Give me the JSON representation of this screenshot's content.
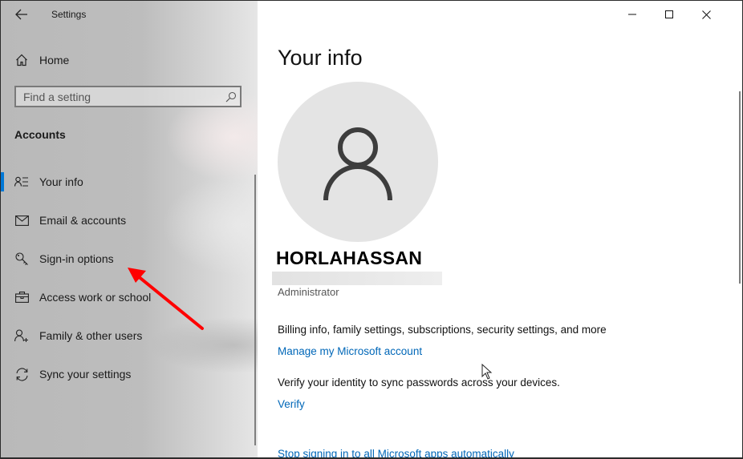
{
  "window": {
    "title": "Settings",
    "controls": {
      "minimize": "minimize-icon",
      "maximize": "maximize-icon",
      "close": "close-icon"
    }
  },
  "sidebar": {
    "back_icon": "back-arrow-icon",
    "home_label": "Home",
    "search": {
      "placeholder": "Find a setting",
      "value": "",
      "icon": "search-icon"
    },
    "section_title": "Accounts",
    "items": [
      {
        "label": "Your info",
        "icon": "person-list-icon",
        "active": true
      },
      {
        "label": "Email & accounts",
        "icon": "envelope-icon",
        "active": false
      },
      {
        "label": "Sign-in options",
        "icon": "key-icon",
        "active": false
      },
      {
        "label": "Access work or school",
        "icon": "briefcase-icon",
        "active": false
      },
      {
        "label": "Family & other users",
        "icon": "person-add-icon",
        "active": false
      },
      {
        "label": "Sync your settings",
        "icon": "sync-icon",
        "active": false
      }
    ],
    "accent_color": "#0078d7"
  },
  "annotation": {
    "type": "red-arrow",
    "points_to": "Sign-in options",
    "color": "#ff0000"
  },
  "main": {
    "page_title": "Your info",
    "avatar_icon": "user-avatar-icon",
    "user_name": "HORLAHASSAN",
    "user_role": "Administrator",
    "billing_text": "Billing info, family settings, subscriptions, security settings, and more",
    "manage_link": "Manage my Microsoft account",
    "verify_text": "Verify your identity to sync passwords across your devices.",
    "verify_link": "Verify",
    "stop_signing_link": "Stop signing in to all Microsoft apps automatically",
    "link_color": "#0067b8"
  }
}
